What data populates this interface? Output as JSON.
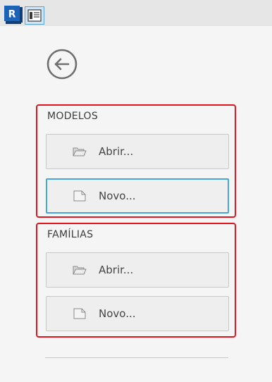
{
  "window": {
    "app_icon": "revit-logo",
    "app_icon_letter": "R",
    "panel_icon": "panel-list-icon"
  },
  "nav": {
    "back_icon": "arrow-left-circle-icon"
  },
  "sections": {
    "models": {
      "title": "MODELOS",
      "open_label": "Abrir...",
      "open_icon": "folder-open-icon",
      "new_label": "Novo...",
      "new_icon": "new-document-icon"
    },
    "families": {
      "title": "FAMÍLIAS",
      "open_label": "Abrir...",
      "open_icon": "folder-open-icon",
      "new_label": "Novo...",
      "new_icon": "new-document-icon"
    }
  },
  "colors": {
    "highlight_border": "#e0151d",
    "focus_border": "#44a7d7",
    "logo_blue": "#1a5fb4"
  }
}
